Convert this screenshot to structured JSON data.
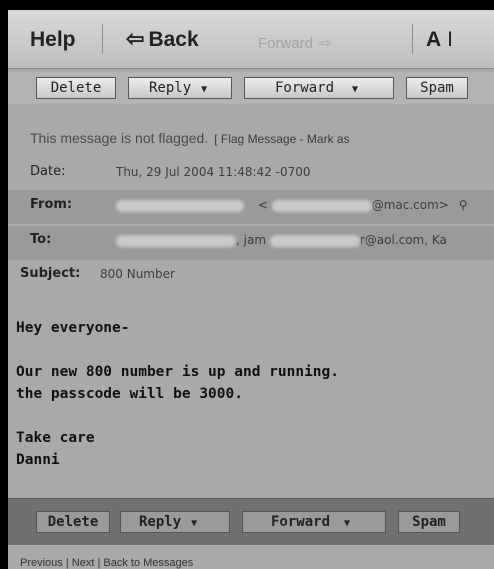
{
  "toolbar": {
    "help": "Help",
    "back": "Back",
    "forward": "Forward",
    "font_size": "A"
  },
  "actions": {
    "delete": "Delete",
    "reply": "Reply",
    "forward": "Forward",
    "spam": "Spam"
  },
  "flag": {
    "status": "This message is not flagged.",
    "link": "[ Flag Message - Mark as"
  },
  "headers": {
    "date_label": "Date:",
    "date_value": "Thu, 29 Jul 2004 11:48:42 -0700",
    "from_label": "From:",
    "from_value": "@mac.com>",
    "to_label": "To:",
    "to_value": ", jam",
    "to_value_2": "r@aol.com, Ka",
    "subject_label": "Subject:",
    "subject_value": "800 Number"
  },
  "message": {
    "line1": "Hey everyone-",
    "line2": "Our new 800 number is up and running.",
    "line3": "the passcode will be 3000.",
    "line4": "Take care",
    "line5": "Danni"
  },
  "bottom_links": {
    "previous": "Previous",
    "next": "Next",
    "back_to": "Back to Messages"
  }
}
